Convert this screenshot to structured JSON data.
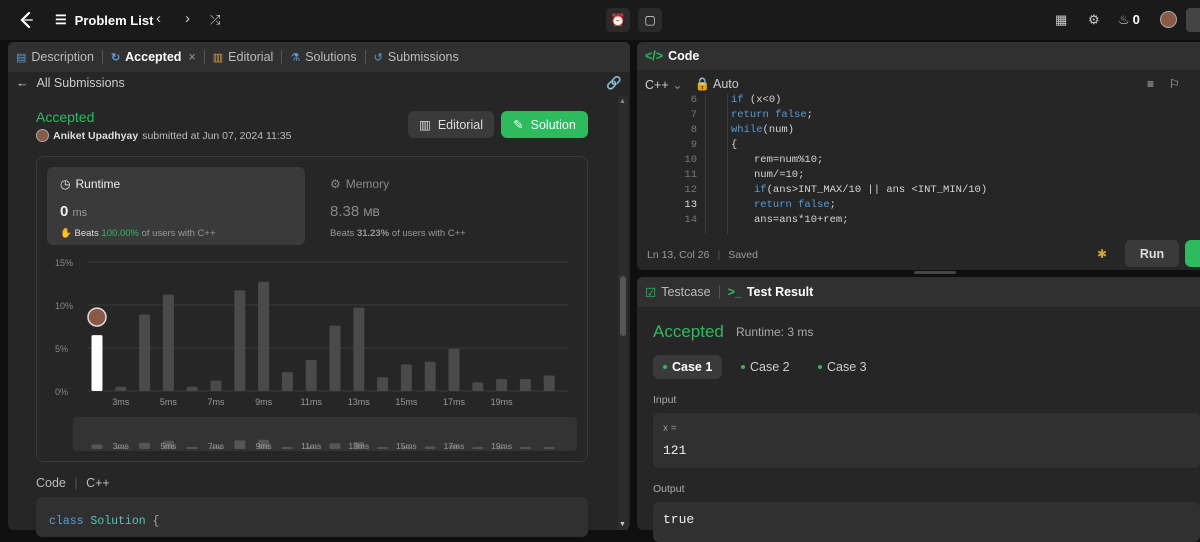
{
  "topbar": {
    "problem_list": "Problem List",
    "streak": "0"
  },
  "left_tabs": [
    {
      "label": "Description"
    },
    {
      "label": "Accepted"
    },
    {
      "label": "Editorial"
    },
    {
      "label": "Solutions"
    },
    {
      "label": "Submissions"
    }
  ],
  "submission": {
    "back_label": "All Submissions",
    "status": "Accepted",
    "author": "Aniket Upadhyay",
    "submitted": "submitted at Jun 07, 2024 11:35",
    "editorial_btn": "Editorial",
    "solution_btn": "Solution"
  },
  "runtime": {
    "title": "Runtime",
    "value": "0",
    "unit": "ms",
    "beats_label": "Beats",
    "beats_pct": "100.00%",
    "beats_suffix": "of users with C++"
  },
  "memory": {
    "title": "Memory",
    "value": "8.38",
    "unit": "MB",
    "beats_label": "Beats",
    "beats_pct": "31.23%",
    "beats_suffix": "of users with C++"
  },
  "chart_data": {
    "type": "bar",
    "yticks": [
      "15%",
      "10%",
      "5%",
      "0%"
    ],
    "ylim": [
      0,
      15
    ],
    "xticks": [
      "3ms",
      "5ms",
      "7ms",
      "9ms",
      "11ms",
      "13ms",
      "15ms",
      "17ms",
      "19ms"
    ],
    "values": [
      6.5,
      0.5,
      8.9,
      11.2,
      0.5,
      1.2,
      11.7,
      12.7,
      2.2,
      3.6,
      7.6,
      9.7,
      1.6,
      3.1,
      3.4,
      4.9,
      1.0,
      1.4,
      1.4,
      1.8
    ],
    "highlight_index": 0,
    "mini_values": [
      3.5,
      1.0,
      4.8,
      6.3,
      0.8,
      1.8,
      6.6,
      7.1,
      1.2,
      1.9,
      4.3,
      5.4,
      0.9,
      1.8,
      1.9,
      2.8,
      0.6,
      0.8,
      0.8,
      1.1
    ]
  },
  "code_section": {
    "title": "Code",
    "lang": "C++",
    "first_line": "class Solution {"
  },
  "editor": {
    "title": "Code",
    "lang": "C++",
    "mode": "Auto",
    "line_numbers": [
      "6",
      "7",
      "8",
      "9",
      "10",
      "11",
      "12",
      "13",
      "14"
    ],
    "lines": [
      {
        "indent": 0,
        "text": "if (x<0)"
      },
      {
        "indent": 0,
        "text": "return false;"
      },
      {
        "indent": 0,
        "text": "while(num)"
      },
      {
        "indent": 0,
        "text": "{"
      },
      {
        "indent": 1,
        "text": "rem=num%10;"
      },
      {
        "indent": 1,
        "text": "num/=10;"
      },
      {
        "indent": 1,
        "text": "if(ans>INT_MAX/10 || ans <INT_MIN/10)"
      },
      {
        "indent": 1,
        "text": "return false;"
      },
      {
        "indent": 1,
        "text": "ans=ans*10+rem;"
      }
    ],
    "status_pos": "Ln 13, Col 26",
    "status_saved": "Saved",
    "run": "Run"
  },
  "result": {
    "tab_testcase": "Testcase",
    "tab_result": "Test Result",
    "status": "Accepted",
    "runtime": "Runtime: 3 ms",
    "cases": [
      "Case 1",
      "Case 2",
      "Case 3"
    ],
    "input_label": "Input",
    "input_var": "x =",
    "input_val": "121",
    "output_label": "Output",
    "output_val": "true"
  },
  "colors": {
    "accent_green": "#2cbb5d",
    "bg": "#0f0f0f",
    "panel": "#262626"
  }
}
